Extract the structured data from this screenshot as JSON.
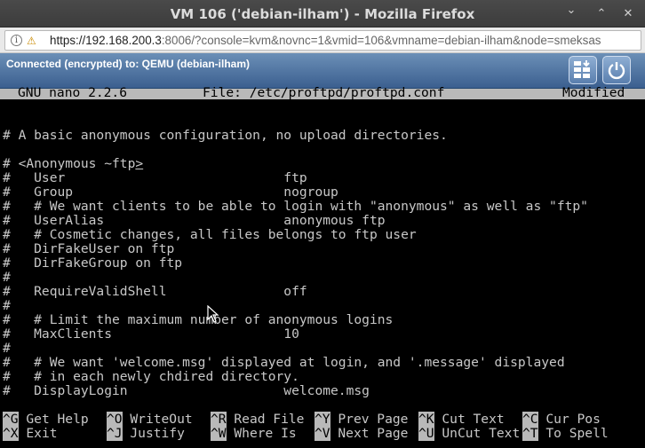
{
  "window": {
    "title": "VM 106 ('debian-ilham') - Mozilla Firefox",
    "minimize_glyph": "⌄",
    "maximize_glyph": "⌃",
    "close_glyph": "✕"
  },
  "urlbar": {
    "host": "https://192.168.200.3",
    "rest": ":8006/?console=kvm&novnc=1&vmid=106&vmname=debian-ilham&node=smeksas"
  },
  "vnc": {
    "status": "Connected (encrypted) to: QEMU (debian-ilham)",
    "apps_icon": "keyboard-apps-icon",
    "power_icon": "power-icon"
  },
  "nano": {
    "version": "GNU nano 2.2.6",
    "file": "File: /etc/proftpd/proftpd.conf",
    "state": "Modified"
  },
  "lines": [
    "# A basic anonymous configuration, no upload directories.",
    "",
    "# <Anonymous ~ftp",
    "#   User                            ftp",
    "#   Group                           nogroup",
    "#   # We want clients to be able to login with \"anonymous\" as well as \"ftp\"",
    "#   UserAlias                       anonymous ftp",
    "#   # Cosmetic changes, all files belongs to ftp user",
    "#   DirFakeUser on ftp",
    "#   DirFakeGroup on ftp",
    "#",
    "#   RequireValidShell               off",
    "#",
    "#   # Limit the maximum number of anonymous logins",
    "#   MaxClients                      10",
    "#",
    "#   # We want 'welcome.msg' displayed at login, and '.message' displayed",
    "#   # in each newly chdired directory.",
    "#   DisplayLogin                    welcome.msg"
  ],
  "cursor_char": ">",
  "shortcuts_row1": [
    {
      "key": "^G",
      "label": "Get Help"
    },
    {
      "key": "^O",
      "label": "WriteOut"
    },
    {
      "key": "^R",
      "label": "Read File"
    },
    {
      "key": "^Y",
      "label": "Prev Page"
    },
    {
      "key": "^K",
      "label": "Cut Text"
    },
    {
      "key": "^C",
      "label": "Cur Pos"
    }
  ],
  "shortcuts_row2": [
    {
      "key": "^X",
      "label": "Exit"
    },
    {
      "key": "^J",
      "label": "Justify"
    },
    {
      "key": "^W",
      "label": "Where Is"
    },
    {
      "key": "^V",
      "label": "Next Page"
    },
    {
      "key": "^U",
      "label": "UnCut Text"
    },
    {
      "key": "^T",
      "label": "To Spell"
    }
  ]
}
